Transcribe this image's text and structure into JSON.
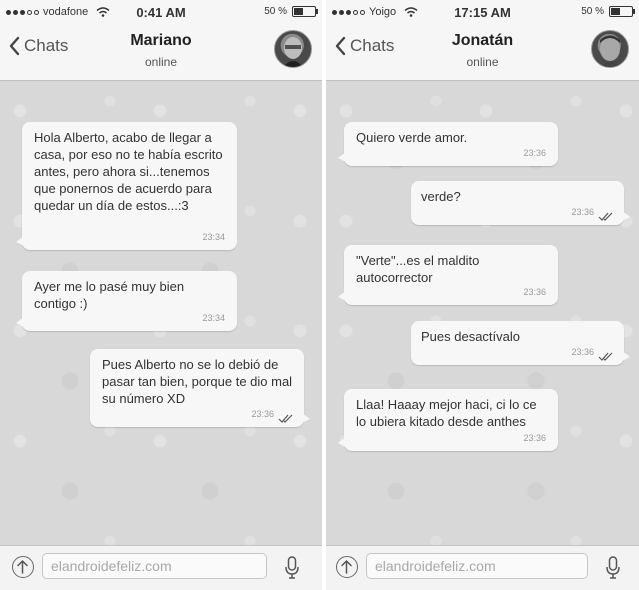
{
  "left": {
    "status": {
      "carrier": "vodafone",
      "time": "0:41 AM",
      "battery": "50 %",
      "battery_level": 0.5
    },
    "nav": {
      "back_label": "Chats",
      "contact_name": "Mariano",
      "contact_status": "online"
    },
    "messages": [
      {
        "direction": "in",
        "text": "Hola Alberto, acabo de llegar a casa, por eso no te había escrito antes, pero ahora si...tenemos que ponernos de acuerdo para quedar un día de estos...:3",
        "time": "23:34",
        "read": false
      },
      {
        "direction": "in",
        "text": "Ayer me lo pasé muy bien contigo :)",
        "time": "23:34",
        "read": false
      },
      {
        "direction": "out",
        "text": "Pues Alberto no se lo debió de pasar tan bien, porque te dio mal su número XD",
        "time": "23:36",
        "read": true
      }
    ],
    "input": {
      "placeholder": "elandroidefeliz.com"
    }
  },
  "right": {
    "status": {
      "carrier": "Yoigo",
      "time": "17:15 AM",
      "battery": "50 %",
      "battery_level": 0.5
    },
    "nav": {
      "back_label": "Chats",
      "contact_name": "Jonatán",
      "contact_status": "online"
    },
    "messages": [
      {
        "direction": "in",
        "text": "Quiero verde amor.",
        "time": "23:36",
        "read": false
      },
      {
        "direction": "out",
        "text": "verde?",
        "time": "23:36",
        "read": true
      },
      {
        "direction": "in",
        "text": "\"Verte\"...es el maldito autocorrector",
        "time": "23:36",
        "read": false
      },
      {
        "direction": "out",
        "text": "Pues desactívalo",
        "time": "23:36",
        "read": true
      },
      {
        "direction": "in",
        "text": "Llaa! Haaay mejor haci, ci lo ce lo ubiera kitado desde anthes",
        "time": "23:36",
        "read": false
      }
    ],
    "input": {
      "placeholder": "elandroidefeliz.com"
    }
  },
  "icons": {
    "back": "chevron-left-icon",
    "wifi": "wifi-icon",
    "battery": "battery-icon",
    "read_receipt": "double-check-icon",
    "upload": "arrow-up-circle-icon",
    "mic": "microphone-icon"
  },
  "colors": {
    "chat_background": "#d8d8d8",
    "bubble": "#f7f7f7",
    "bar": "#f6f6f6"
  }
}
